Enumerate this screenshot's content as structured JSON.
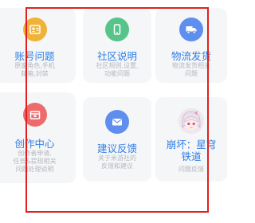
{
  "cards": [
    {
      "title": "账号问题",
      "desc": "原家角色,手机\n邮箱,封禁",
      "icon": "account-card-icon",
      "icon_color": "#f0b33a"
    },
    {
      "title": "社区说明",
      "desc": "社区规则,设置,\n功能问题",
      "icon": "phone-icon",
      "icon_color": "#57c58a"
    },
    {
      "title": "物流发货",
      "desc": "物流发货相关\n问题",
      "icon": "delivery-truck-icon",
      "icon_color": "#5e8fef"
    },
    {
      "title": "创作中心",
      "desc": "创作者申请,\n任务&提现相关\n问题处理说明",
      "icon": "creator-icon",
      "icon_color": "#ee6b6b"
    },
    {
      "title": "建议反馈",
      "desc": "关于米游社的\n反馈和建议",
      "icon": "mail-icon",
      "icon_color": "#5e8fef"
    },
    {
      "title": "崩坏：星穹\n铁道",
      "desc": "问题反馈",
      "icon": "game-avatar-icon",
      "icon_color": "#d9b7d1"
    }
  ]
}
